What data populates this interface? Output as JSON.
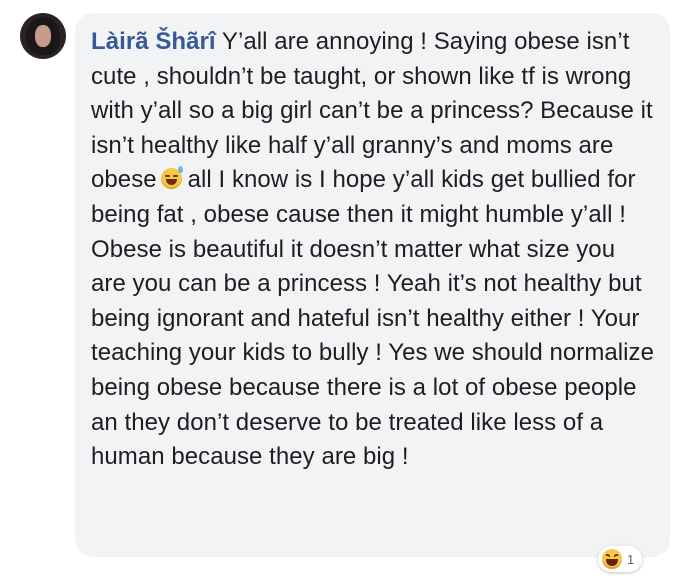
{
  "comment": {
    "author": "Làirã Šhãrî",
    "text_before_emoji": " Y’all are annoying ! Saying obese isn’t cute , shouldn’t be taught, or shown like tf is wrong with y’all so a big girl can’t be a princess? Because it isn’t healthy like half y’all granny’s and moms are obese",
    "emoji": "sweat-smile-emoji",
    "text_after_emoji": "all I know is I hope y’all kids get bullied for being fat , obese cause then it might humble y’all ! Obese is beautiful it doesn’t matter what size you are you can be a princess ! Yeah it’s not healthy but being ignorant and hateful isn’t healthy either ! Your teaching your kids to bully ! Yes we should normalize being obese because there is a lot of obese people an they don’t deserve to be treated like less of a human because they are big !"
  },
  "reactions": {
    "icon": "haha-icon",
    "count": "1"
  },
  "colors": {
    "author_link": "#385898",
    "bubble_bg": "#f2f3f5",
    "text": "#1c1e21"
  }
}
